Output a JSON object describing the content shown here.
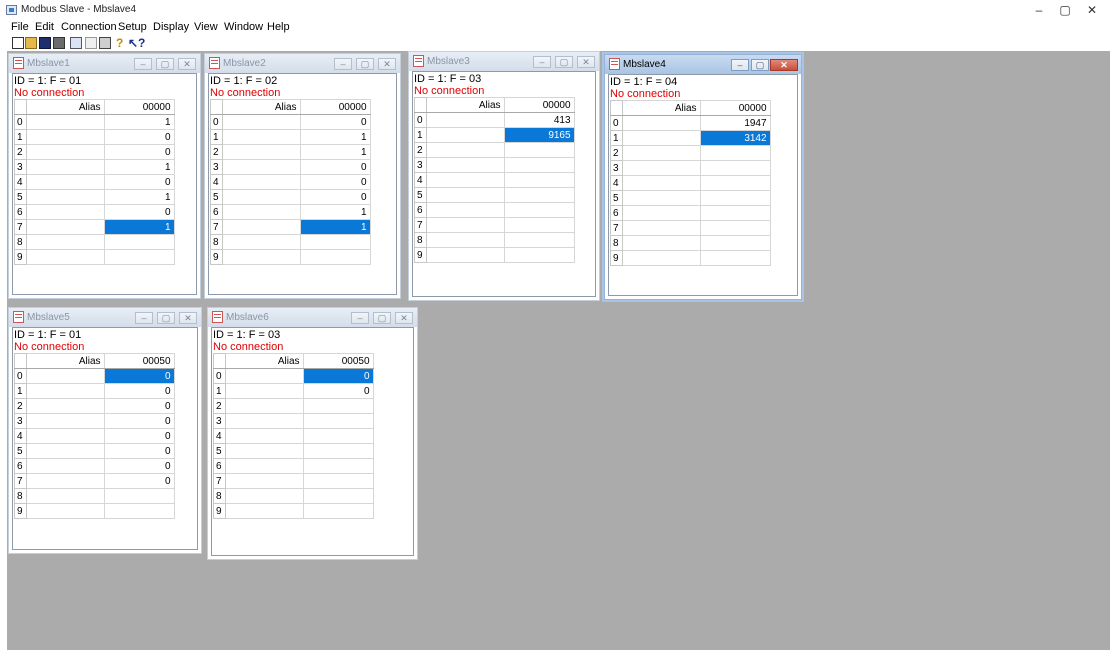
{
  "app": {
    "title": "Modbus Slave - Mbslave4",
    "controls": {
      "minimize": "–",
      "maximize": "▢",
      "close": "✕"
    }
  },
  "menu": [
    "File",
    "Edit",
    "Connection",
    "Setup",
    "Display",
    "View",
    "Window",
    "Help"
  ],
  "toolbar": {
    "buttons": [
      "new-icon",
      "open-icon",
      "save-icon",
      "print-icon",
      "window-icon",
      "comm-icon",
      "printer-icon",
      "help-icon",
      "context-help-icon"
    ]
  },
  "colors": {
    "mdi_background": "#ababab",
    "selection": "#0a78d7",
    "error_text": "#e00000"
  },
  "windows": [
    {
      "title": "Mbslave1",
      "id_line": "ID = 1: F = 01",
      "status": "No connection",
      "alias_header": "Alias",
      "address_header": "00000",
      "active": false,
      "rows": [
        {
          "n": "0",
          "alias": "",
          "value": "1"
        },
        {
          "n": "1",
          "alias": "",
          "value": "0"
        },
        {
          "n": "2",
          "alias": "",
          "value": "0"
        },
        {
          "n": "3",
          "alias": "",
          "value": "1"
        },
        {
          "n": "4",
          "alias": "",
          "value": "0"
        },
        {
          "n": "5",
          "alias": "",
          "value": "1"
        },
        {
          "n": "6",
          "alias": "",
          "value": "0"
        },
        {
          "n": "7",
          "alias": "",
          "value": "1",
          "selected": true
        },
        {
          "n": "8",
          "alias": "",
          "value": ""
        },
        {
          "n": "9",
          "alias": "",
          "value": ""
        }
      ]
    },
    {
      "title": "Mbslave2",
      "id_line": "ID = 1: F = 02",
      "status": "No connection",
      "alias_header": "Alias",
      "address_header": "00000",
      "active": false,
      "rows": [
        {
          "n": "0",
          "alias": "",
          "value": "0"
        },
        {
          "n": "1",
          "alias": "",
          "value": "1"
        },
        {
          "n": "2",
          "alias": "",
          "value": "1"
        },
        {
          "n": "3",
          "alias": "",
          "value": "0"
        },
        {
          "n": "4",
          "alias": "",
          "value": "0"
        },
        {
          "n": "5",
          "alias": "",
          "value": "0"
        },
        {
          "n": "6",
          "alias": "",
          "value": "1"
        },
        {
          "n": "7",
          "alias": "",
          "value": "1",
          "selected": true
        },
        {
          "n": "8",
          "alias": "",
          "value": ""
        },
        {
          "n": "9",
          "alias": "",
          "value": ""
        }
      ]
    },
    {
      "title": "Mbslave3",
      "id_line": "ID = 1: F = 03",
      "status": "No connection",
      "alias_header": "Alias",
      "address_header": "00000",
      "active": false,
      "rows": [
        {
          "n": "0",
          "alias": "",
          "value": "413"
        },
        {
          "n": "1",
          "alias": "",
          "value": "9165",
          "selected": true
        },
        {
          "n": "2",
          "alias": "",
          "value": ""
        },
        {
          "n": "3",
          "alias": "",
          "value": ""
        },
        {
          "n": "4",
          "alias": "",
          "value": ""
        },
        {
          "n": "5",
          "alias": "",
          "value": ""
        },
        {
          "n": "6",
          "alias": "",
          "value": ""
        },
        {
          "n": "7",
          "alias": "",
          "value": ""
        },
        {
          "n": "8",
          "alias": "",
          "value": ""
        },
        {
          "n": "9",
          "alias": "",
          "value": ""
        }
      ]
    },
    {
      "title": "Mbslave4",
      "id_line": "ID = 1: F = 04",
      "status": "No connection",
      "alias_header": "Alias",
      "address_header": "00000",
      "active": true,
      "rows": [
        {
          "n": "0",
          "alias": "",
          "value": "1947"
        },
        {
          "n": "1",
          "alias": "",
          "value": "3142",
          "selected": true
        },
        {
          "n": "2",
          "alias": "",
          "value": ""
        },
        {
          "n": "3",
          "alias": "",
          "value": ""
        },
        {
          "n": "4",
          "alias": "",
          "value": ""
        },
        {
          "n": "5",
          "alias": "",
          "value": ""
        },
        {
          "n": "6",
          "alias": "",
          "value": ""
        },
        {
          "n": "7",
          "alias": "",
          "value": ""
        },
        {
          "n": "8",
          "alias": "",
          "value": ""
        },
        {
          "n": "9",
          "alias": "",
          "value": ""
        }
      ]
    },
    {
      "title": "Mbslave5",
      "id_line": "ID = 1: F = 01",
      "status": "No connection",
      "alias_header": "Alias",
      "address_header": "00050",
      "active": false,
      "rows": [
        {
          "n": "0",
          "alias": "",
          "value": "0",
          "selected": true
        },
        {
          "n": "1",
          "alias": "",
          "value": "0"
        },
        {
          "n": "2",
          "alias": "",
          "value": "0"
        },
        {
          "n": "3",
          "alias": "",
          "value": "0"
        },
        {
          "n": "4",
          "alias": "",
          "value": "0"
        },
        {
          "n": "5",
          "alias": "",
          "value": "0"
        },
        {
          "n": "6",
          "alias": "",
          "value": "0"
        },
        {
          "n": "7",
          "alias": "",
          "value": "0"
        },
        {
          "n": "8",
          "alias": "",
          "value": ""
        },
        {
          "n": "9",
          "alias": "",
          "value": ""
        }
      ]
    },
    {
      "title": "Mbslave6",
      "id_line": "ID = 1: F = 03",
      "status": "No connection",
      "alias_header": "Alias",
      "address_header": "00050",
      "active": false,
      "rows": [
        {
          "n": "0",
          "alias": "",
          "value": "0",
          "selected": true
        },
        {
          "n": "1",
          "alias": "",
          "value": "0"
        },
        {
          "n": "2",
          "alias": "",
          "value": ""
        },
        {
          "n": "3",
          "alias": "",
          "value": ""
        },
        {
          "n": "4",
          "alias": "",
          "value": ""
        },
        {
          "n": "5",
          "alias": "",
          "value": ""
        },
        {
          "n": "6",
          "alias": "",
          "value": ""
        },
        {
          "n": "7",
          "alias": "",
          "value": ""
        },
        {
          "n": "8",
          "alias": "",
          "value": ""
        },
        {
          "n": "9",
          "alias": "",
          "value": ""
        }
      ]
    }
  ]
}
